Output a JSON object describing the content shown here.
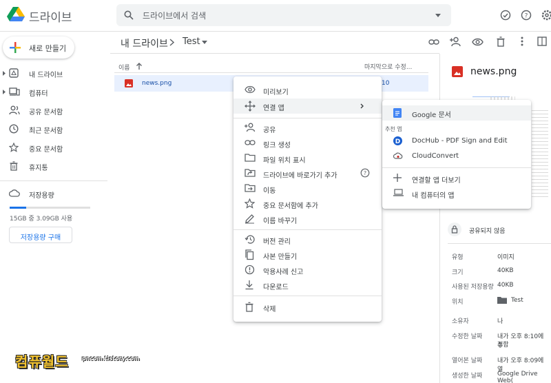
{
  "header": {
    "app_name": "드라이브",
    "search_placeholder": "드라이브에서 검색"
  },
  "sidebar": {
    "new_label": "새로 만들기",
    "items": [
      {
        "label": "내 드라이브",
        "icon": "my-drive-icon"
      },
      {
        "label": "컴퓨터",
        "icon": "computer-icon"
      },
      {
        "label": "공유 문서함",
        "icon": "shared-icon"
      },
      {
        "label": "최근 문서함",
        "icon": "clock-icon"
      },
      {
        "label": "중요 문서함",
        "icon": "star-icon"
      },
      {
        "label": "휴지통",
        "icon": "trash-icon"
      },
      {
        "label": "저장용량",
        "icon": "cloud-icon"
      }
    ],
    "storage_text": "15GB 중 3.09GB 사용",
    "storage_fraction": 0.206,
    "buy_label": "저장용량 구매"
  },
  "main": {
    "breadcrumb_root": "내 드라이브",
    "breadcrumb_current": "Test",
    "col_name": "이름",
    "col_modified": "마지막으로 수정...",
    "file": {
      "name": "news.png",
      "modified": "10"
    }
  },
  "context_menu": {
    "items": [
      {
        "label": "미리보기",
        "icon": "eye-icon"
      },
      {
        "label": "연결 앱",
        "icon": "move-arrows-icon"
      },
      {
        "label": "공유",
        "icon": "person-add-icon"
      },
      {
        "label": "링크 생성",
        "icon": "link-icon"
      },
      {
        "label": "파일 위치 표시",
        "icon": "folder-icon"
      },
      {
        "label": "드라이브에 바로가기 추가",
        "icon": "shortcut-icon"
      },
      {
        "label": "이동",
        "icon": "move-folder-icon"
      },
      {
        "label": "중요 문서함에 추가",
        "icon": "star-icon"
      },
      {
        "label": "이름 바꾸기",
        "icon": "pencil-icon"
      },
      {
        "label": "버전 관리",
        "icon": "history-icon"
      },
      {
        "label": "사본 만들기",
        "icon": "copy-icon"
      },
      {
        "label": "악용사례 신고",
        "icon": "report-icon"
      },
      {
        "label": "다운로드",
        "icon": "download-icon"
      },
      {
        "label": "삭제",
        "icon": "trash-icon"
      }
    ]
  },
  "submenu": {
    "items": [
      {
        "label": "Google 문서",
        "icon": "google-docs-icon"
      },
      {
        "label": "DocHub - PDF Sign and Edit",
        "icon": "dochub-icon"
      },
      {
        "label": "CloudConvert",
        "icon": "cloudconvert-icon"
      },
      {
        "label": "연결할 앱 더보기",
        "icon": "plus-icon"
      },
      {
        "label": "내 컴퓨터의 앱",
        "icon": "laptop-icon"
      }
    ],
    "section_label": "추천 앱"
  },
  "details": {
    "title": "news.png",
    "share_status": "공유되지 않음",
    "rows": [
      {
        "label": "유형",
        "value": "이미지"
      },
      {
        "label": "크기",
        "value": "40KB"
      },
      {
        "label": "사용된 저장용량",
        "value": "40KB"
      },
      {
        "label": "위치",
        "value": "Test"
      },
      {
        "label": "소유자",
        "value": "나"
      },
      {
        "label": "수정한 날짜",
        "value": "내가 오후 8:10에 수",
        "value2": "정함"
      },
      {
        "label": "열어본 날짜",
        "value": "내가 오후 8:09에 열"
      },
      {
        "label": "생성한 날짜",
        "value": "Google Drive Web("
      }
    ]
  },
  "watermark": {
    "main": "컴퓨월드",
    "sub": "pncom.tistory.com"
  },
  "colors": {
    "accent": "#1a73e8",
    "selected_row": "#e8f0fe",
    "file_red": "#d93025"
  }
}
